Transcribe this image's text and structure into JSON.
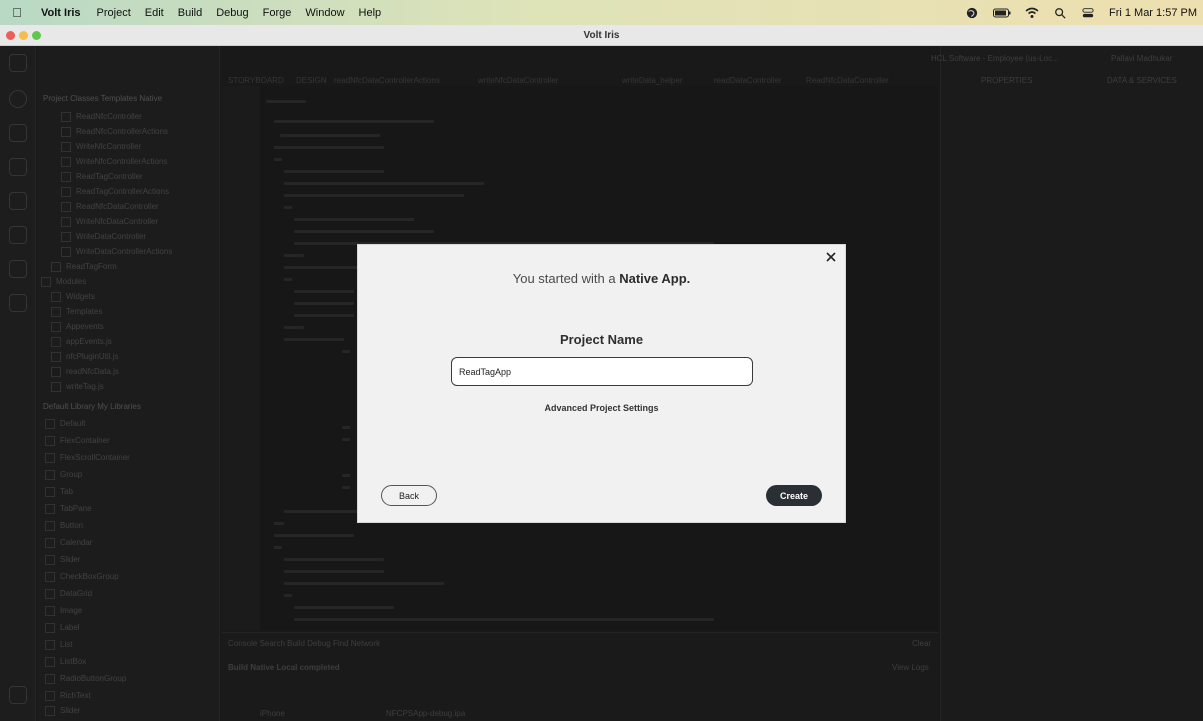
{
  "menubar": {
    "app_name": "Volt Iris",
    "items": [
      "Project",
      "Edit",
      "Build",
      "Debug",
      "Forge",
      "Window",
      "Help"
    ],
    "datetime": "Fri 1 Mar  1:57 PM"
  },
  "window": {
    "title": "Volt Iris"
  },
  "background": {
    "panel_tabs": "Project   Classes   Templates   Native",
    "tree_items": [
      "ReadNfcController",
      "ReadNfcControllerActions",
      "WriteNfcController",
      "WriteNfcControllerActions",
      "ReadTagController",
      "ReadTagControllerActions",
      "ReadNfcDataController",
      "WriteNfcDataController",
      "WriteDataController",
      "WriteDataControllerActions",
      "ReadTagForm",
      "Modules",
      "Widgets",
      "Templates",
      "Appevents",
      "appEvents.js",
      "nfcPluginUtil.js",
      "readNfcData.js",
      "writeTag.js"
    ],
    "library_tabs": "Default Library   My Libraries",
    "library_items": [
      "Default",
      "FlexContainer",
      "FlexScrollContainer",
      "Group",
      "Tab",
      "TabPane",
      "Button",
      "Calendar",
      "Slider",
      "CheckBoxGroup",
      "DataGrid",
      "Image",
      "Label",
      "List",
      "ListBox",
      "RadioButtonGroup",
      "RichText",
      "Slider"
    ],
    "right_tabs": "PROPERTIES",
    "right_tabs2": "DATA & SERVICES",
    "bottom_tabs": "Console   Search   Build   Debug   Find   Network",
    "build_status": "Build Native Local completed",
    "build_device": "iPhone",
    "build_file": "NFCPSApp-debug.ipa",
    "view_logs": "View Logs",
    "clear": "Clear",
    "account": "HCL Software - Employee (us-Loc...",
    "user": "Pallavi Madhukar"
  },
  "modal": {
    "headline_prefix": "You started with a ",
    "headline_bold": "Native App.",
    "project_name_label": "Project Name",
    "project_name_value": "ReadTagApp",
    "advanced_settings_link": "Advanced Project Settings",
    "back_label": "Back",
    "create_label": "Create"
  }
}
